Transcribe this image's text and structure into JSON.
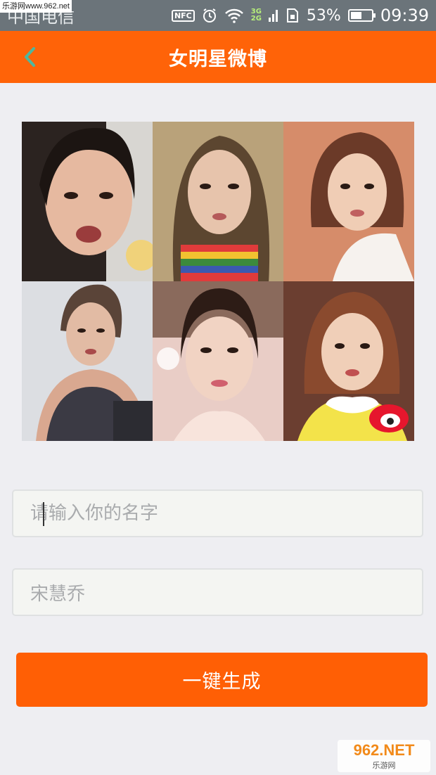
{
  "status_bar": {
    "carrier": "中国电信",
    "watermark": "乐游网www.962.net",
    "nfc": "NFC",
    "net_top": "3G",
    "net_bottom": "2G",
    "battery_percent": "53%",
    "battery_level": 0.53,
    "time": "09:39"
  },
  "app_bar": {
    "back_icon": "chevron-left-icon",
    "title": "女明星微博"
  },
  "photo_grid": {
    "photos": [
      {
        "name": "celebrity-photo-1",
        "bg": "#2b2320"
      },
      {
        "name": "celebrity-photo-2",
        "bg": "#8a7b5a"
      },
      {
        "name": "celebrity-photo-3",
        "bg": "#c0735a"
      },
      {
        "name": "celebrity-photo-4",
        "bg": "#d7d9de"
      },
      {
        "name": "celebrity-photo-5",
        "bg": "#e8c8c4"
      },
      {
        "name": "celebrity-photo-6",
        "bg": "#7a4a38"
      }
    ]
  },
  "form": {
    "name_placeholder": "请输入你的名字",
    "name_value": "",
    "example_text": "宋慧乔",
    "generate_button": "一键生成"
  },
  "colors": {
    "accent": "#ff6308",
    "back_icon": "#4db8a0"
  },
  "watermark_logo": {
    "top": "962.NET",
    "bottom": "乐游网"
  }
}
